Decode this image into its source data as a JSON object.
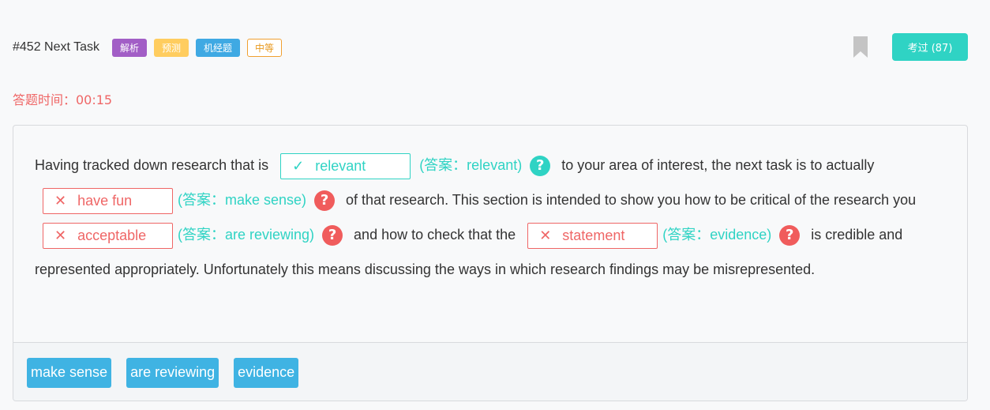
{
  "header": {
    "task_title": "#452 Next Task",
    "tags": [
      "解析",
      "预测",
      "机经题",
      "中等"
    ],
    "pass_button": "考过 (87)"
  },
  "timer": {
    "label": "答题时间：00:15"
  },
  "passage": {
    "seg1": "Having tracked down research that is",
    "blank1": {
      "mark": "✓",
      "value": "relevant",
      "answer": "(答案：relevant)",
      "status": "correct"
    },
    "seg2": "to your area of interest, the next task is to actually",
    "blank2": {
      "mark": "✕",
      "value": "have fun",
      "answer": "(答案：make sense)",
      "status": "wrong"
    },
    "seg3": "of that research. This section is intended to show you how to be critical of the research you",
    "blank3": {
      "mark": "✕",
      "value": "acceptable",
      "answer": "(答案：are reviewing)",
      "status": "wrong"
    },
    "seg4": "and how to check that the",
    "blank4": {
      "mark": "✕",
      "value": "statement",
      "answer": "(答案：evidence)",
      "status": "wrong"
    },
    "seg5": "is credible and represented appropriately. Unfortunately this means discussing the ways in which research findings may be misrepresented.",
    "help_icon": "?"
  },
  "options": [
    "make sense",
    "are reviewing",
    "evidence"
  ],
  "colors": {
    "accent_teal": "#2fd3c4",
    "error_red": "#ef6666",
    "option_blue": "#3fb3e3"
  },
  "icons": {
    "bookmark": "bookmark-icon",
    "help": "question-circle-icon"
  }
}
